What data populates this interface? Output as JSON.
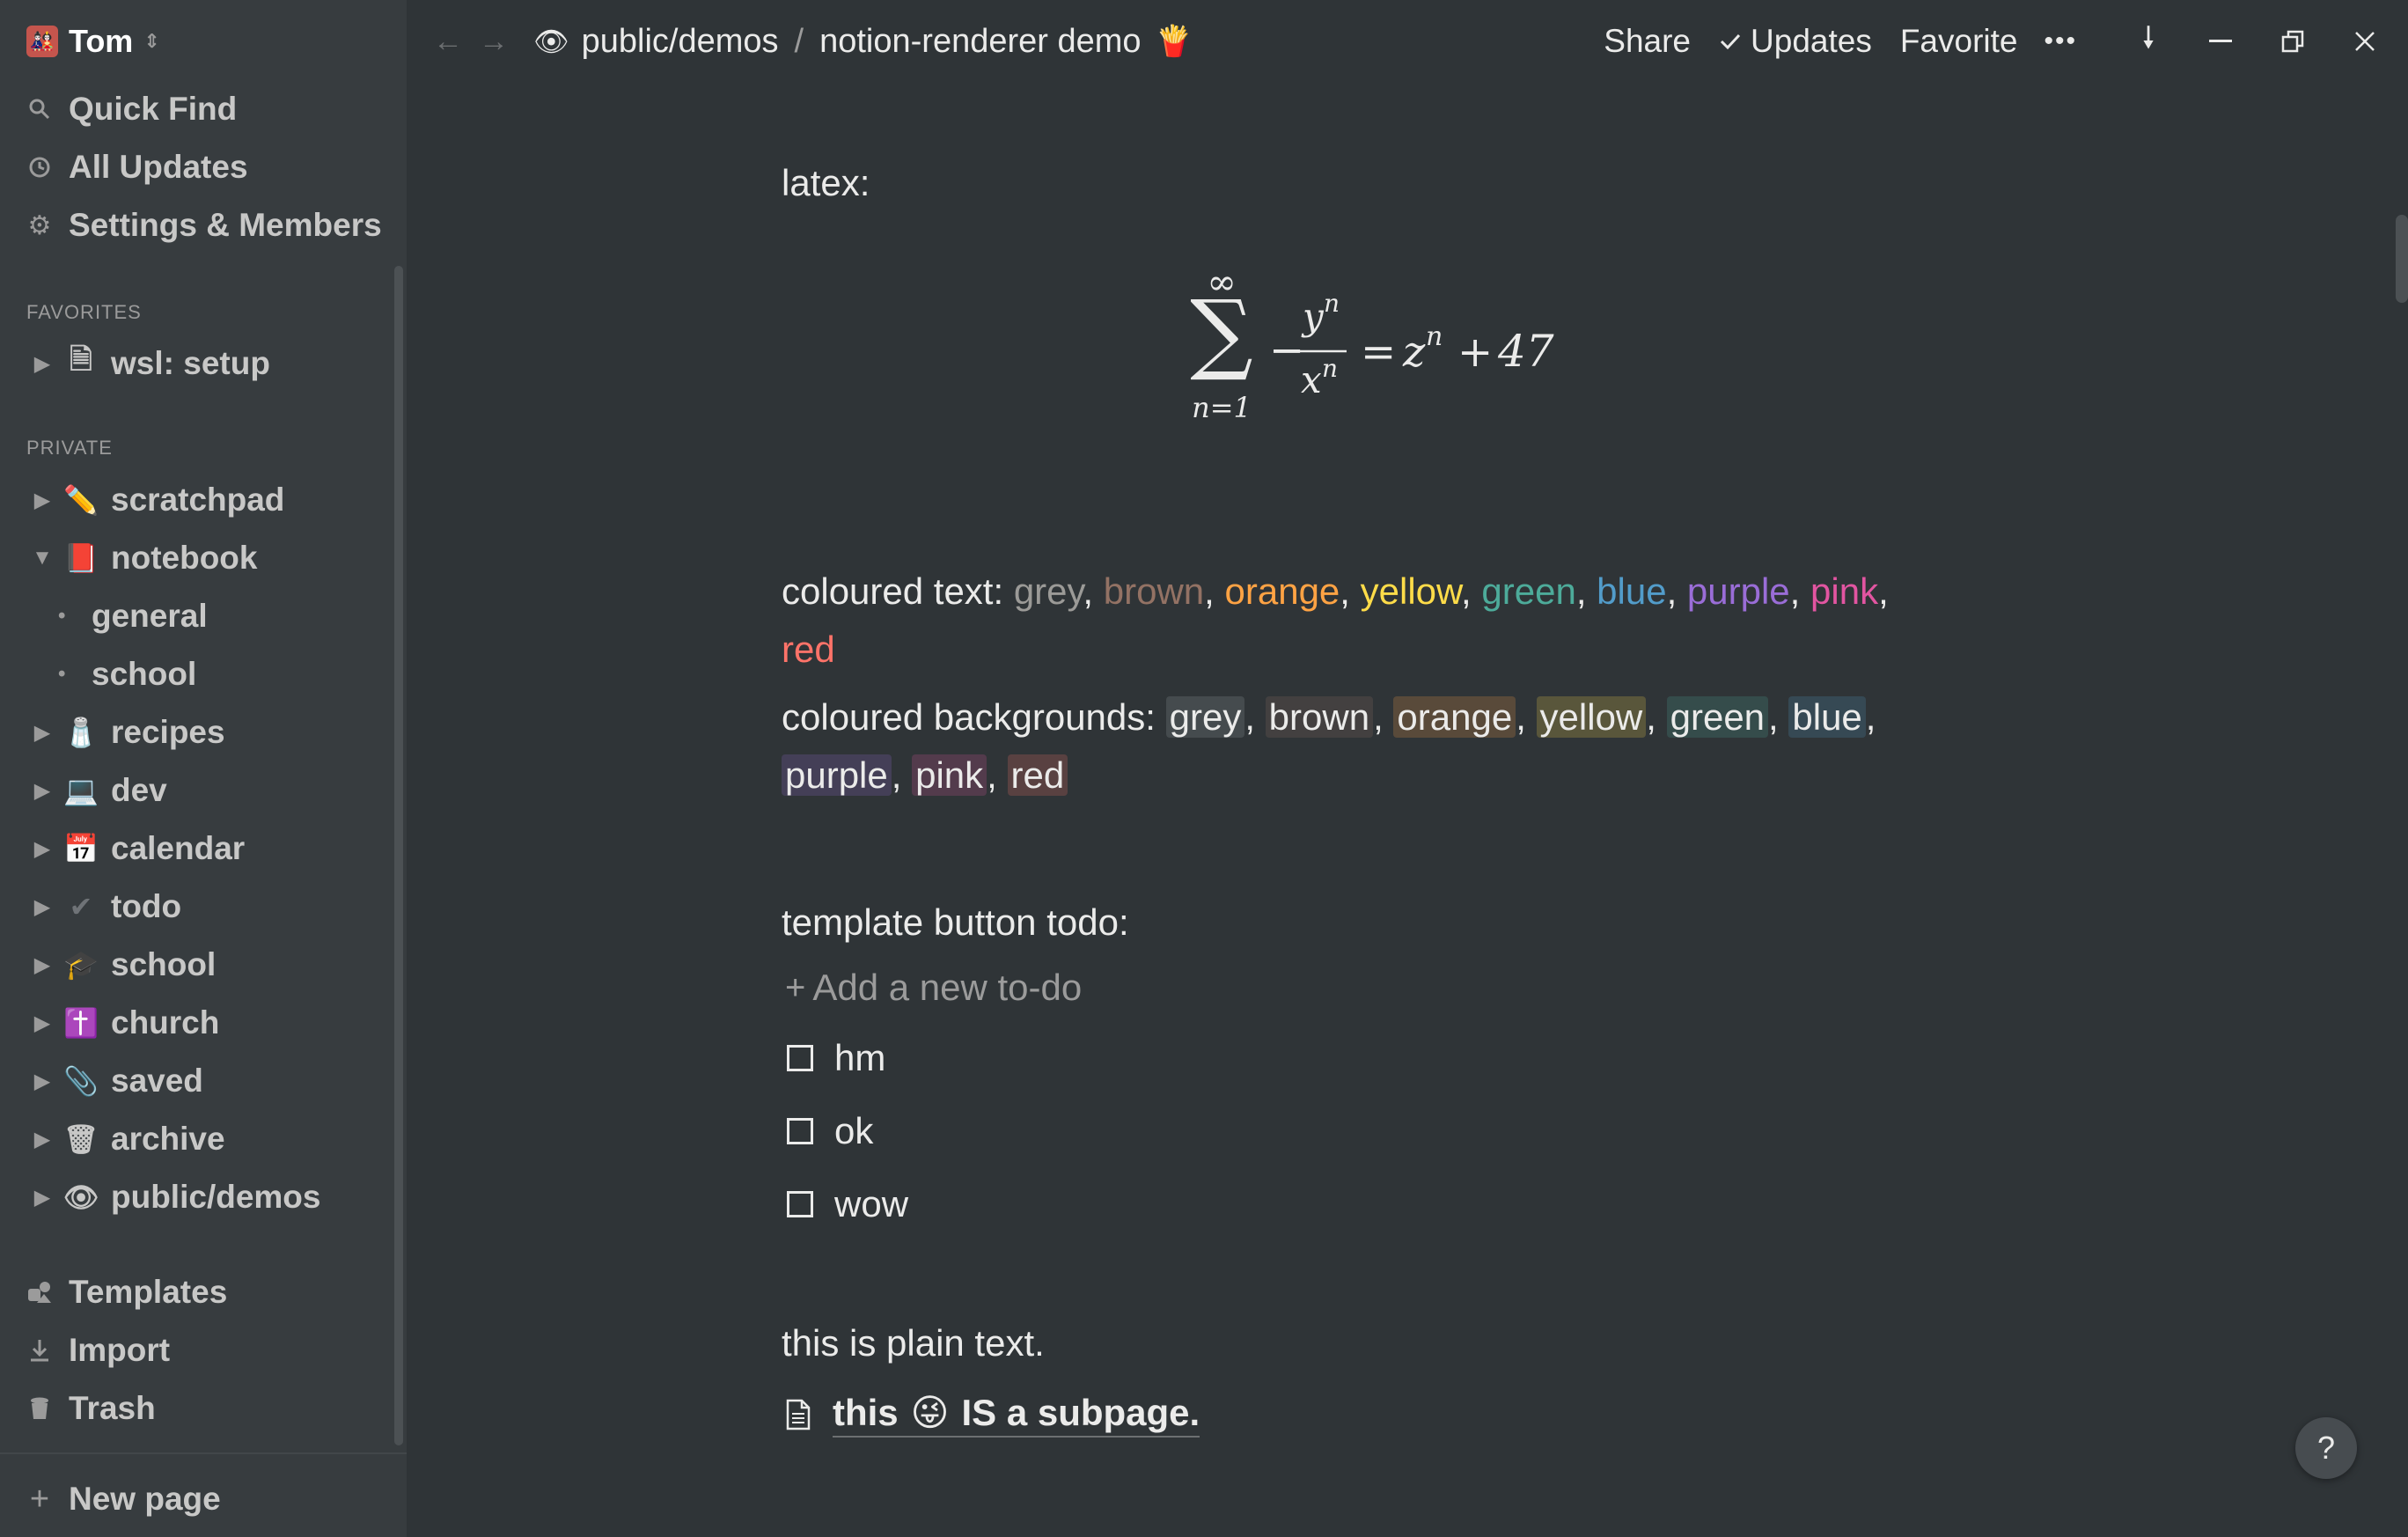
{
  "workspace": {
    "name": "Tom",
    "avatar_emoji": "🎎",
    "switch_icon": "chevron-updown-icon"
  },
  "sidebar": {
    "top_items": [
      {
        "label": "Quick Find",
        "icon": "search-icon"
      },
      {
        "label": "All Updates",
        "icon": "clock-icon"
      },
      {
        "label": "Settings & Members",
        "icon": "gear-icon"
      }
    ],
    "favorites_heading": "FAVORITES",
    "favorites": [
      {
        "label": "wsl: setup",
        "emoji": "🗎",
        "expanded": false
      }
    ],
    "private_heading": "PRIVATE",
    "private": [
      {
        "label": "scratchpad",
        "emoji": "✏️",
        "expanded": false
      },
      {
        "label": "notebook",
        "emoji": "📕",
        "expanded": true,
        "children": [
          "general",
          "school"
        ]
      },
      {
        "label": "recipes",
        "emoji": "🧂",
        "expanded": false
      },
      {
        "label": "dev",
        "emoji": "💻",
        "expanded": false
      },
      {
        "label": "calendar",
        "emoji": "📅",
        "expanded": false
      },
      {
        "label": "todo",
        "emoji": "✔",
        "expanded": false
      },
      {
        "label": "school",
        "emoji": "🎓",
        "expanded": false
      },
      {
        "label": "church",
        "emoji": "✝️",
        "expanded": false
      },
      {
        "label": "saved",
        "emoji": "📎",
        "expanded": false
      },
      {
        "label": "archive",
        "emoji": "🗑",
        "expanded": false
      },
      {
        "label": "public/demos",
        "emoji": "👁",
        "expanded": false
      }
    ],
    "bottom_items": [
      {
        "label": "Templates",
        "icon": "templates-icon"
      },
      {
        "label": "Import",
        "icon": "import-icon"
      },
      {
        "label": "Trash",
        "icon": "trash-icon"
      }
    ],
    "new_page_label": "New page"
  },
  "topbar": {
    "breadcrumbs": [
      {
        "label": "public/demos",
        "emoji": "👁"
      },
      {
        "label": "notion-renderer demo",
        "emoji": "🍟"
      }
    ],
    "separator": "/",
    "share_label": "Share",
    "updates_label": "Updates",
    "favorite_label": "Favorite",
    "more_label": "•••"
  },
  "content": {
    "latex_label": "latex:",
    "coloured_text_label": "coloured text:",
    "coloured_text": [
      {
        "word": "grey",
        "color": "#9b9a97"
      },
      {
        "word": "brown",
        "color": "#937264"
      },
      {
        "word": "orange",
        "color": "#ffa344"
      },
      {
        "word": "yellow",
        "color": "#ffdc49"
      },
      {
        "word": "green",
        "color": "#4dab9a"
      },
      {
        "word": "blue",
        "color": "#529cca"
      },
      {
        "word": "purple",
        "color": "#9a6dd7"
      },
      {
        "word": "pink",
        "color": "#e255a1"
      },
      {
        "word": "red",
        "color": "#ff7369"
      }
    ],
    "coloured_bg_label": "coloured backgrounds:",
    "coloured_backgrounds": [
      {
        "word": "grey",
        "bg": "#454b4e"
      },
      {
        "word": "brown",
        "bg": "#434040"
      },
      {
        "word": "orange",
        "bg": "#594a3a"
      },
      {
        "word": "yellow",
        "bg": "#59563b"
      },
      {
        "word": "green",
        "bg": "#354c4b"
      },
      {
        "word": "blue",
        "bg": "#364954"
      },
      {
        "word": "purple",
        "bg": "#443f57"
      },
      {
        "word": "pink",
        "bg": "#533b4c"
      },
      {
        "word": "red",
        "bg": "#594141"
      }
    ],
    "template_label": "template button todo:",
    "add_todo_label": "Add a new to-do",
    "todos": [
      {
        "label": "hm",
        "checked": false
      },
      {
        "label": "ok",
        "checked": false
      },
      {
        "label": "wow",
        "checked": false
      }
    ],
    "plain_text": "this is plain text.",
    "subpage": {
      "before": "this",
      "emoji": "😜",
      "after": "IS a subpage."
    }
  },
  "help_label": "?"
}
